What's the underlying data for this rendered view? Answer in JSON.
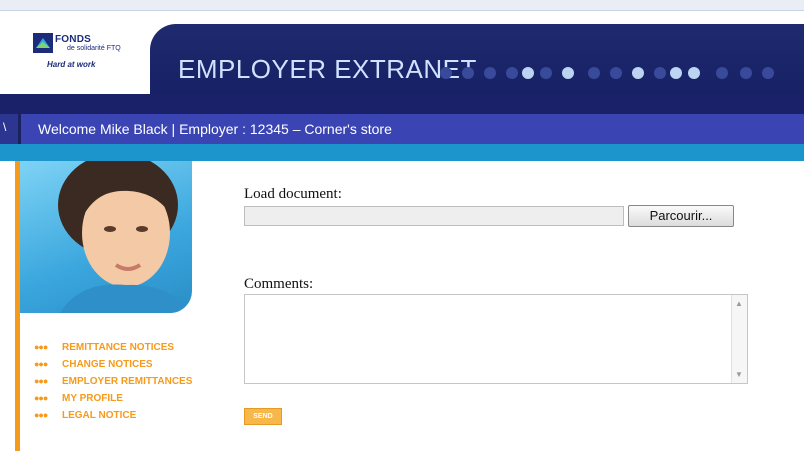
{
  "header": {
    "logo": {
      "name": "FONDS",
      "subname": "de solidarité FTQ",
      "tagline": "Hard at work"
    },
    "title": "EMPLOYER EXTRANET",
    "welcome": "Welcome Mike Black |  Employer : 12345 – Corner's store",
    "left_glyph": "\\"
  },
  "sidebar": {
    "photo_icon": "person-photo",
    "items": [
      {
        "label": "REMITTANCE NOTICES"
      },
      {
        "label": "CHANGE NOTICES"
      },
      {
        "label": "EMPLOYER REMITTANCES"
      },
      {
        "label": "MY PROFILE"
      },
      {
        "label": "LEGAL NOTICE"
      }
    ]
  },
  "form": {
    "load_label": "Load document:",
    "file_value": "",
    "browse_label": "Parcourir...",
    "comments_label": "Comments:",
    "comments_value": "",
    "send_label": "SEND"
  },
  "colors": {
    "navy": "#1f2a6f",
    "welcome_bar": "#3a45b3",
    "cyan": "#1c95cc",
    "accent_orange": "#f59a1b"
  }
}
